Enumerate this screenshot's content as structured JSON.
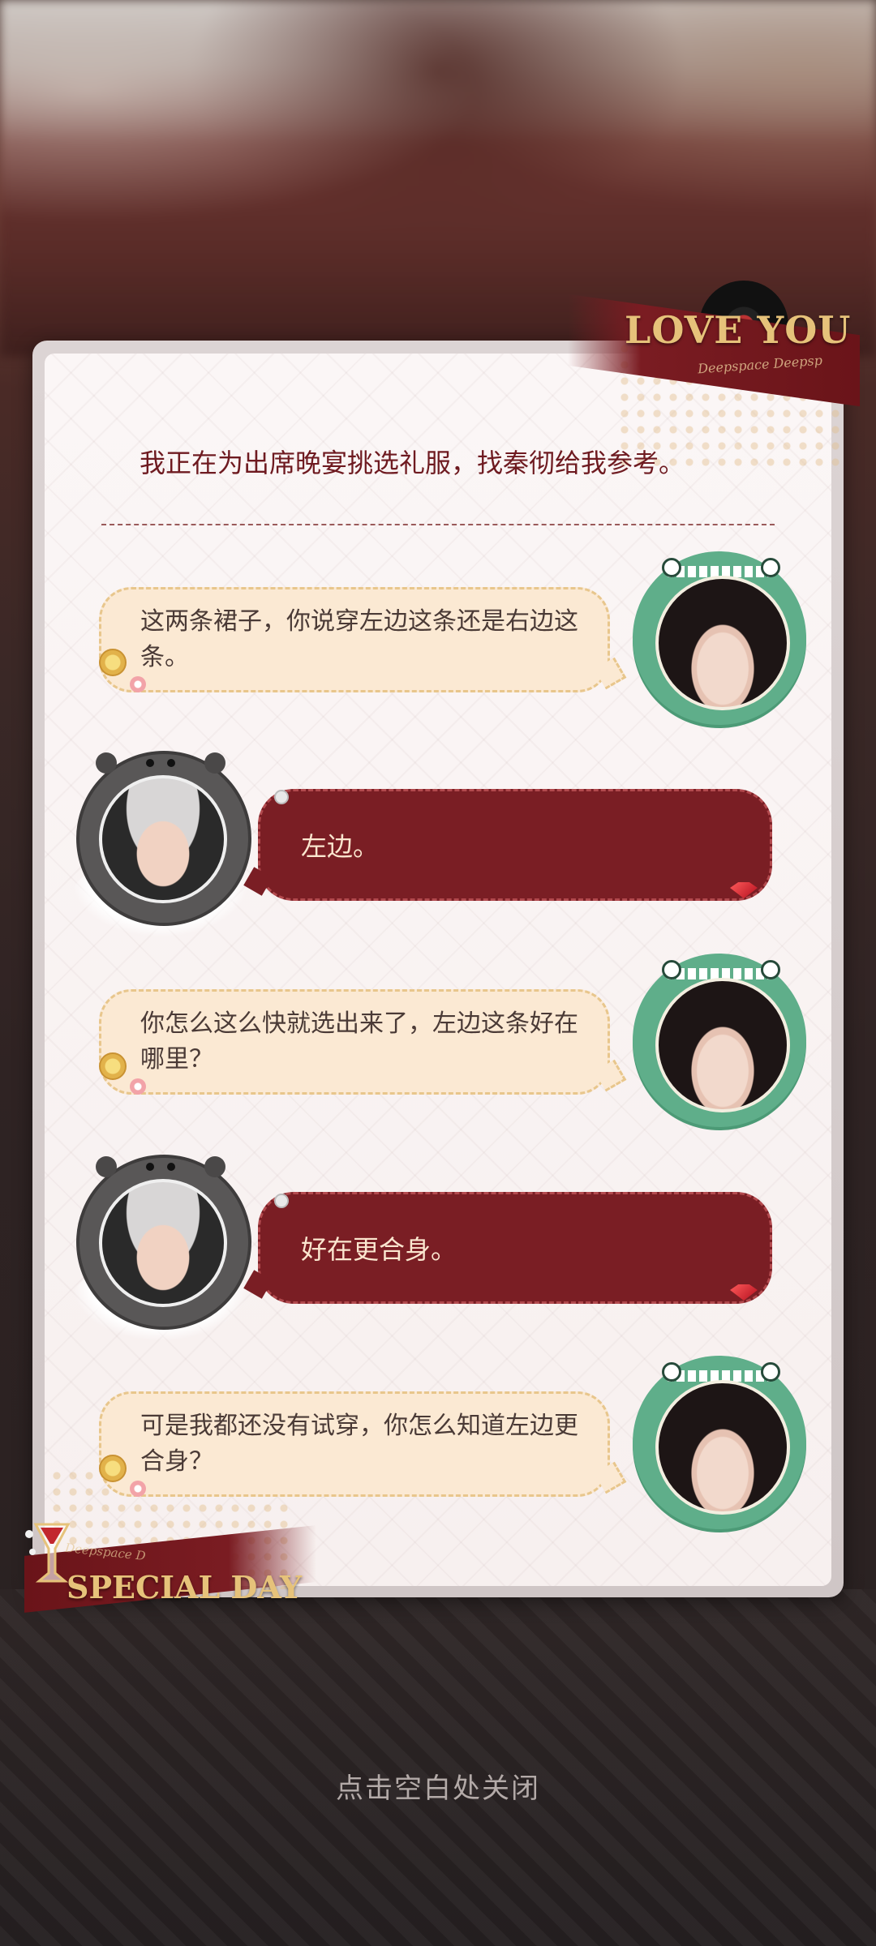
{
  "header": {
    "prompt": "我正在为出席晚宴挑选礼服，找秦彻给我参考。"
  },
  "decor": {
    "top_ribbon": "LOVE YOU",
    "top_ribbon_sub": "Deepspace Deepsp",
    "bottom_ribbon": "SPECIAL DAY",
    "bottom_ribbon_sub": "Deepspace D"
  },
  "messages": [
    {
      "speaker": "her",
      "text": "这两条裙子，你说穿左边这条还是右边这条。"
    },
    {
      "speaker": "him",
      "text": "左边。"
    },
    {
      "speaker": "her",
      "text": "你怎么这么快就选出来了，左边这条好在哪里？"
    },
    {
      "speaker": "him",
      "text": "好在更合身。"
    },
    {
      "speaker": "her",
      "text": "可是我都还没有试穿，你怎么知道左边更合身？"
    }
  ],
  "footer": {
    "close_hint": "点击空白处关闭"
  },
  "colors": {
    "accent_red": "#7a1e24",
    "her_bubble": "#fbe9d3",
    "gold": "#e6c27a",
    "her_avatar_ring": "#5fae8a",
    "him_avatar_ring": "#595757"
  },
  "icons": {
    "coin": "coin-icon",
    "gem": "gem-icon",
    "record": "vinyl-record-icon",
    "glass": "wine-glass-icon"
  }
}
